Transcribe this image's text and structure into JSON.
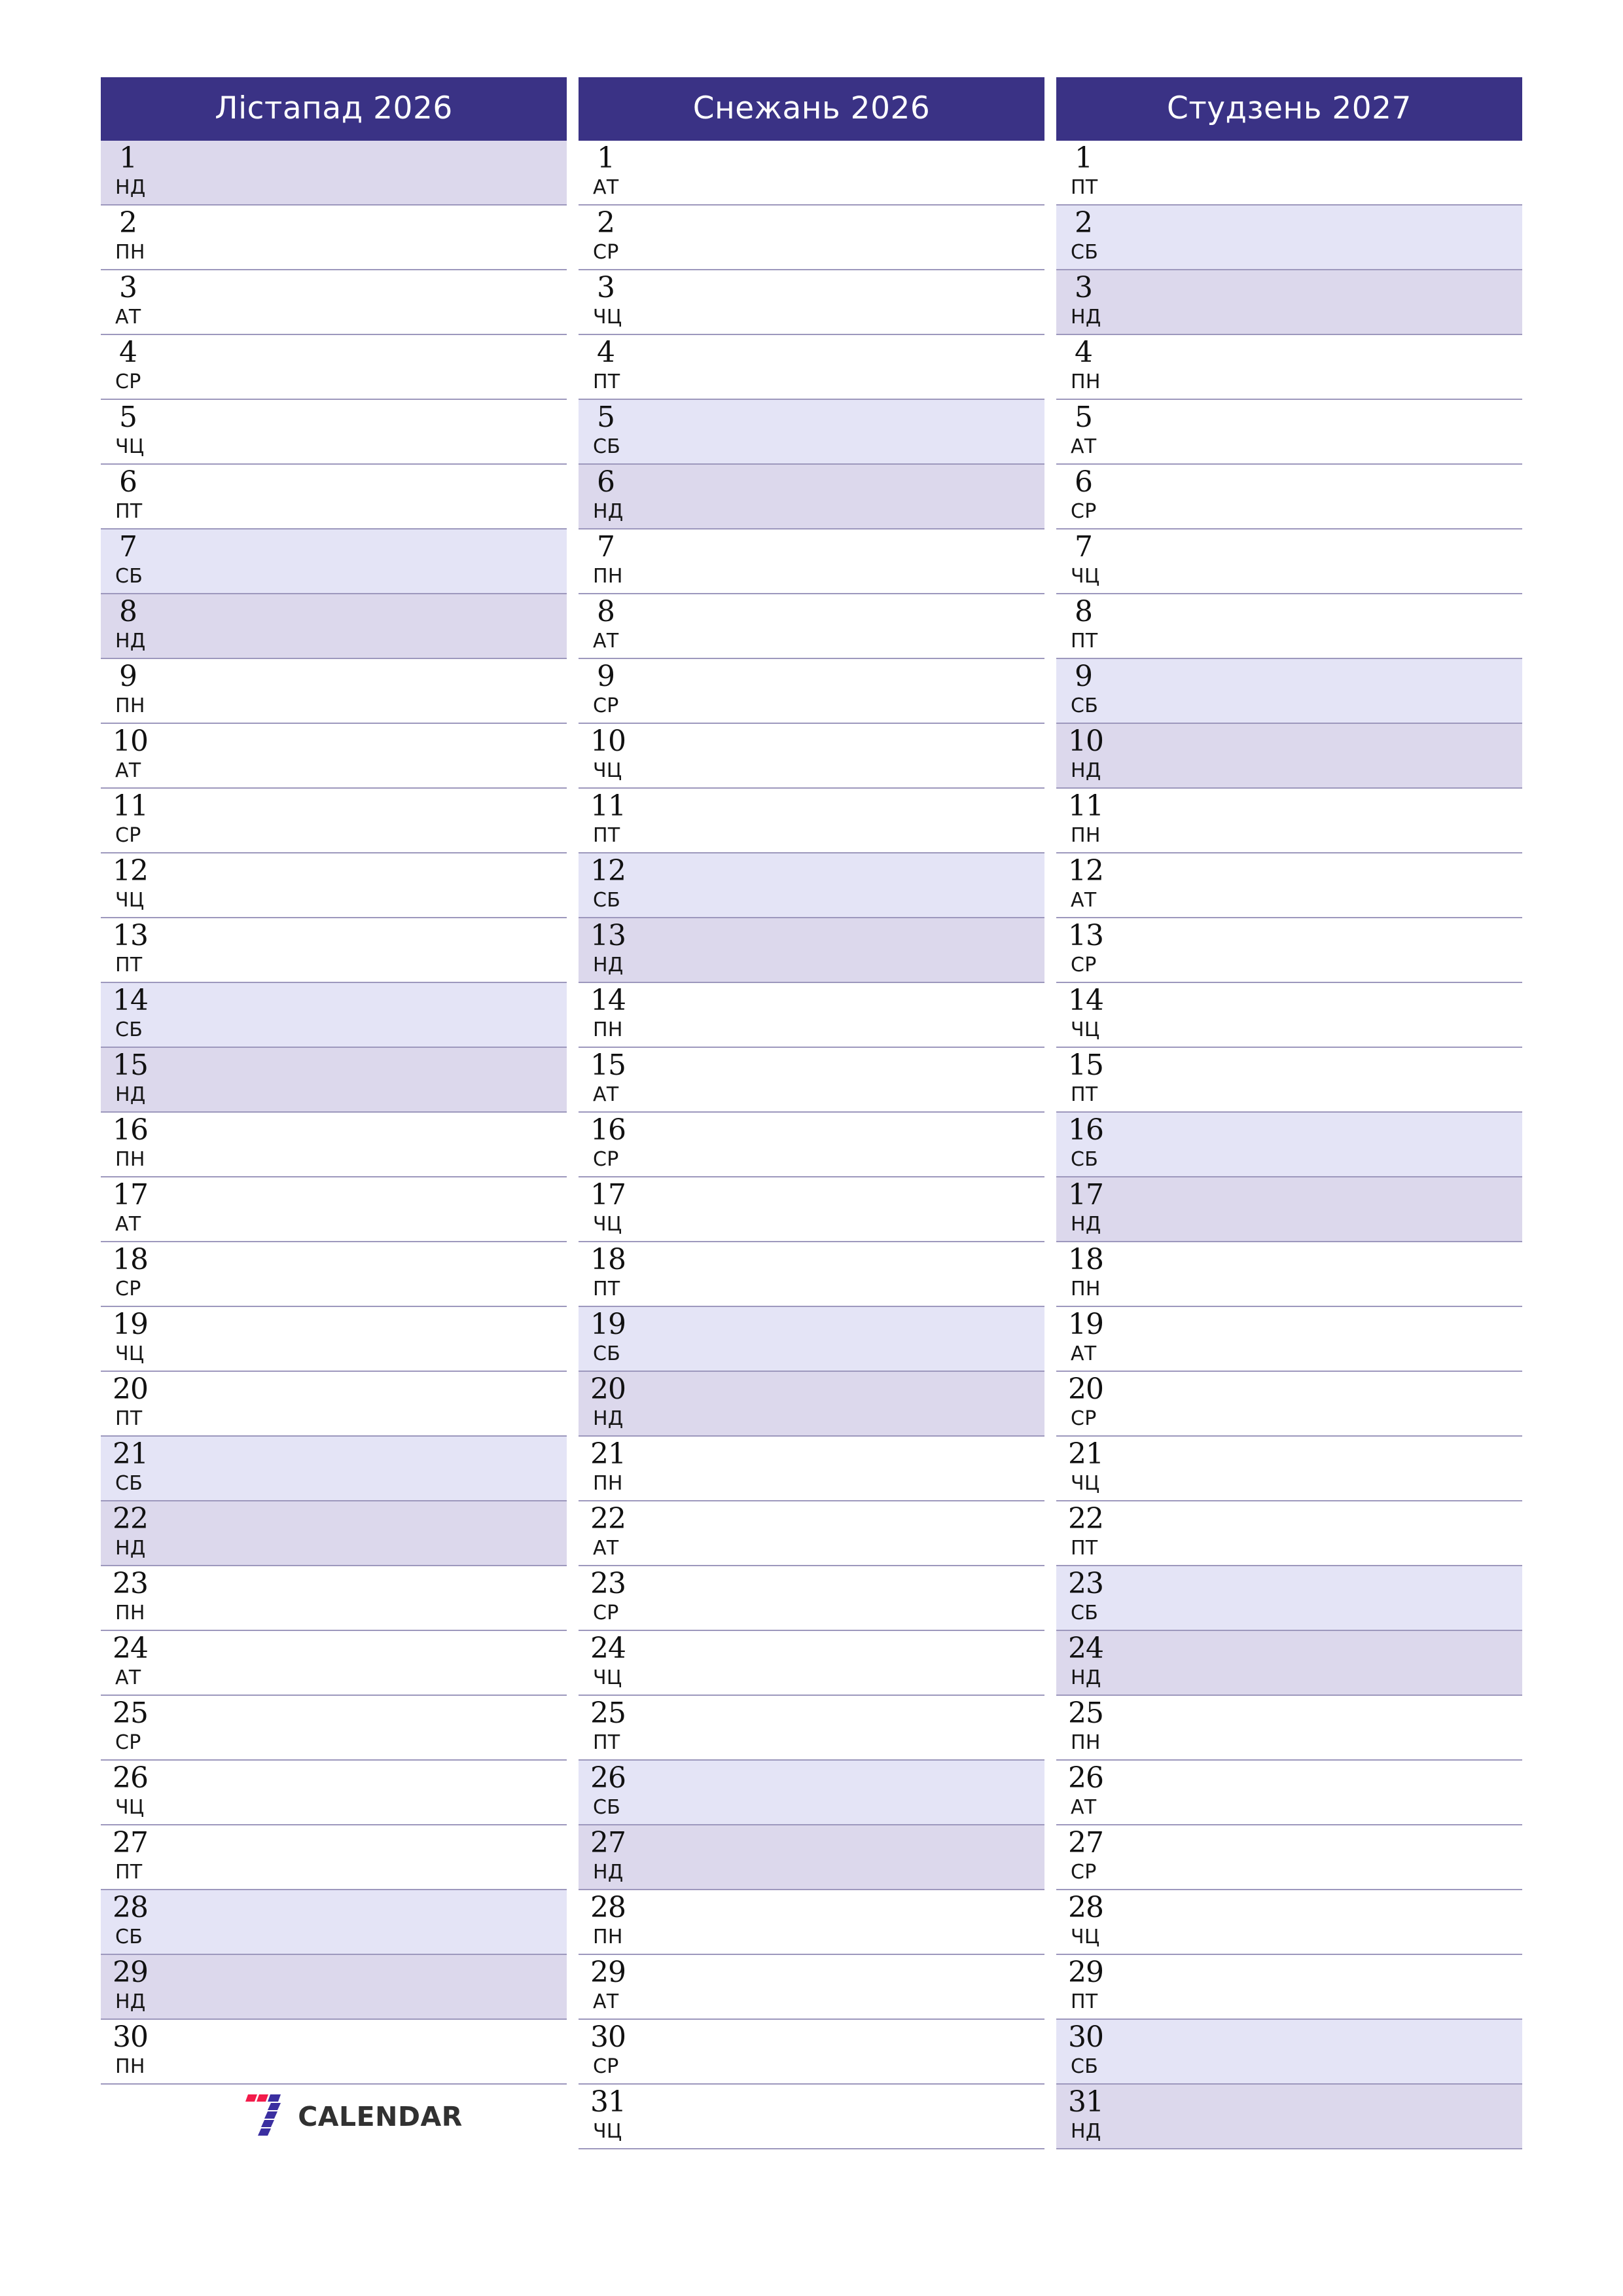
{
  "colors": {
    "header_bg": "#3a3285",
    "header_text": "#ffffff",
    "saturday_bg": "#e4e4f6",
    "sunday_bg": "#dcd8ec",
    "row_line": "#9d98bd",
    "page_bg": "#ffffff",
    "logo_red": "#f31b4a",
    "logo_purple": "#3b2fa0",
    "logo_text": "#313131"
  },
  "weekday_names": {
    "mon": "ПН",
    "tue": "АТ",
    "wed": "СР",
    "thu": "ЧЦ",
    "fri": "ПТ",
    "sat": "СБ",
    "sun": "НД"
  },
  "logo": {
    "name": "7calendar-logo",
    "text": "CALENDAR",
    "mark": "stylized-seven"
  },
  "months": [
    {
      "title": "Лістапад 2026",
      "month_name": "Лістапад",
      "year": "2026",
      "days": [
        {
          "num": "1",
          "wd": "НД",
          "type": "sun"
        },
        {
          "num": "2",
          "wd": "ПН",
          "type": "weekday"
        },
        {
          "num": "3",
          "wd": "АТ",
          "type": "weekday"
        },
        {
          "num": "4",
          "wd": "СР",
          "type": "weekday"
        },
        {
          "num": "5",
          "wd": "ЧЦ",
          "type": "weekday"
        },
        {
          "num": "6",
          "wd": "ПТ",
          "type": "weekday"
        },
        {
          "num": "7",
          "wd": "СБ",
          "type": "sat"
        },
        {
          "num": "8",
          "wd": "НД",
          "type": "sun"
        },
        {
          "num": "9",
          "wd": "ПН",
          "type": "weekday"
        },
        {
          "num": "10",
          "wd": "АТ",
          "type": "weekday"
        },
        {
          "num": "11",
          "wd": "СР",
          "type": "weekday"
        },
        {
          "num": "12",
          "wd": "ЧЦ",
          "type": "weekday"
        },
        {
          "num": "13",
          "wd": "ПТ",
          "type": "weekday"
        },
        {
          "num": "14",
          "wd": "СБ",
          "type": "sat"
        },
        {
          "num": "15",
          "wd": "НД",
          "type": "sun"
        },
        {
          "num": "16",
          "wd": "ПН",
          "type": "weekday"
        },
        {
          "num": "17",
          "wd": "АТ",
          "type": "weekday"
        },
        {
          "num": "18",
          "wd": "СР",
          "type": "weekday"
        },
        {
          "num": "19",
          "wd": "ЧЦ",
          "type": "weekday"
        },
        {
          "num": "20",
          "wd": "ПТ",
          "type": "weekday"
        },
        {
          "num": "21",
          "wd": "СБ",
          "type": "sat"
        },
        {
          "num": "22",
          "wd": "НД",
          "type": "sun"
        },
        {
          "num": "23",
          "wd": "ПН",
          "type": "weekday"
        },
        {
          "num": "24",
          "wd": "АТ",
          "type": "weekday"
        },
        {
          "num": "25",
          "wd": "СР",
          "type": "weekday"
        },
        {
          "num": "26",
          "wd": "ЧЦ",
          "type": "weekday"
        },
        {
          "num": "27",
          "wd": "ПТ",
          "type": "weekday"
        },
        {
          "num": "28",
          "wd": "СБ",
          "type": "sat"
        },
        {
          "num": "29",
          "wd": "НД",
          "type": "sun"
        },
        {
          "num": "30",
          "wd": "ПН",
          "type": "weekday"
        }
      ],
      "has_logo": true
    },
    {
      "title": "Снежань 2026",
      "month_name": "Снежань",
      "year": "2026",
      "days": [
        {
          "num": "1",
          "wd": "АТ",
          "type": "weekday"
        },
        {
          "num": "2",
          "wd": "СР",
          "type": "weekday"
        },
        {
          "num": "3",
          "wd": "ЧЦ",
          "type": "weekday"
        },
        {
          "num": "4",
          "wd": "ПТ",
          "type": "weekday"
        },
        {
          "num": "5",
          "wd": "СБ",
          "type": "sat"
        },
        {
          "num": "6",
          "wd": "НД",
          "type": "sun"
        },
        {
          "num": "7",
          "wd": "ПН",
          "type": "weekday"
        },
        {
          "num": "8",
          "wd": "АТ",
          "type": "weekday"
        },
        {
          "num": "9",
          "wd": "СР",
          "type": "weekday"
        },
        {
          "num": "10",
          "wd": "ЧЦ",
          "type": "weekday"
        },
        {
          "num": "11",
          "wd": "ПТ",
          "type": "weekday"
        },
        {
          "num": "12",
          "wd": "СБ",
          "type": "sat"
        },
        {
          "num": "13",
          "wd": "НД",
          "type": "sun"
        },
        {
          "num": "14",
          "wd": "ПН",
          "type": "weekday"
        },
        {
          "num": "15",
          "wd": "АТ",
          "type": "weekday"
        },
        {
          "num": "16",
          "wd": "СР",
          "type": "weekday"
        },
        {
          "num": "17",
          "wd": "ЧЦ",
          "type": "weekday"
        },
        {
          "num": "18",
          "wd": "ПТ",
          "type": "weekday"
        },
        {
          "num": "19",
          "wd": "СБ",
          "type": "sat"
        },
        {
          "num": "20",
          "wd": "НД",
          "type": "sun"
        },
        {
          "num": "21",
          "wd": "ПН",
          "type": "weekday"
        },
        {
          "num": "22",
          "wd": "АТ",
          "type": "weekday"
        },
        {
          "num": "23",
          "wd": "СР",
          "type": "weekday"
        },
        {
          "num": "24",
          "wd": "ЧЦ",
          "type": "weekday"
        },
        {
          "num": "25",
          "wd": "ПТ",
          "type": "weekday"
        },
        {
          "num": "26",
          "wd": "СБ",
          "type": "sat"
        },
        {
          "num": "27",
          "wd": "НД",
          "type": "sun"
        },
        {
          "num": "28",
          "wd": "ПН",
          "type": "weekday"
        },
        {
          "num": "29",
          "wd": "АТ",
          "type": "weekday"
        },
        {
          "num": "30",
          "wd": "СР",
          "type": "weekday"
        },
        {
          "num": "31",
          "wd": "ЧЦ",
          "type": "weekday"
        }
      ],
      "has_logo": false
    },
    {
      "title": "Студзень 2027",
      "month_name": "Студзень",
      "year": "2027",
      "days": [
        {
          "num": "1",
          "wd": "ПТ",
          "type": "weekday"
        },
        {
          "num": "2",
          "wd": "СБ",
          "type": "sat"
        },
        {
          "num": "3",
          "wd": "НД",
          "type": "sun"
        },
        {
          "num": "4",
          "wd": "ПН",
          "type": "weekday"
        },
        {
          "num": "5",
          "wd": "АТ",
          "type": "weekday"
        },
        {
          "num": "6",
          "wd": "СР",
          "type": "weekday"
        },
        {
          "num": "7",
          "wd": "ЧЦ",
          "type": "weekday"
        },
        {
          "num": "8",
          "wd": "ПТ",
          "type": "weekday"
        },
        {
          "num": "9",
          "wd": "СБ",
          "type": "sat"
        },
        {
          "num": "10",
          "wd": "НД",
          "type": "sun"
        },
        {
          "num": "11",
          "wd": "ПН",
          "type": "weekday"
        },
        {
          "num": "12",
          "wd": "АТ",
          "type": "weekday"
        },
        {
          "num": "13",
          "wd": "СР",
          "type": "weekday"
        },
        {
          "num": "14",
          "wd": "ЧЦ",
          "type": "weekday"
        },
        {
          "num": "15",
          "wd": "ПТ",
          "type": "weekday"
        },
        {
          "num": "16",
          "wd": "СБ",
          "type": "sat"
        },
        {
          "num": "17",
          "wd": "НД",
          "type": "sun"
        },
        {
          "num": "18",
          "wd": "ПН",
          "type": "weekday"
        },
        {
          "num": "19",
          "wd": "АТ",
          "type": "weekday"
        },
        {
          "num": "20",
          "wd": "СР",
          "type": "weekday"
        },
        {
          "num": "21",
          "wd": "ЧЦ",
          "type": "weekday"
        },
        {
          "num": "22",
          "wd": "ПТ",
          "type": "weekday"
        },
        {
          "num": "23",
          "wd": "СБ",
          "type": "sat"
        },
        {
          "num": "24",
          "wd": "НД",
          "type": "sun"
        },
        {
          "num": "25",
          "wd": "ПН",
          "type": "weekday"
        },
        {
          "num": "26",
          "wd": "АТ",
          "type": "weekday"
        },
        {
          "num": "27",
          "wd": "СР",
          "type": "weekday"
        },
        {
          "num": "28",
          "wd": "ЧЦ",
          "type": "weekday"
        },
        {
          "num": "29",
          "wd": "ПТ",
          "type": "weekday"
        },
        {
          "num": "30",
          "wd": "СБ",
          "type": "sat"
        },
        {
          "num": "31",
          "wd": "НД",
          "type": "sun"
        }
      ],
      "has_logo": false
    }
  ]
}
